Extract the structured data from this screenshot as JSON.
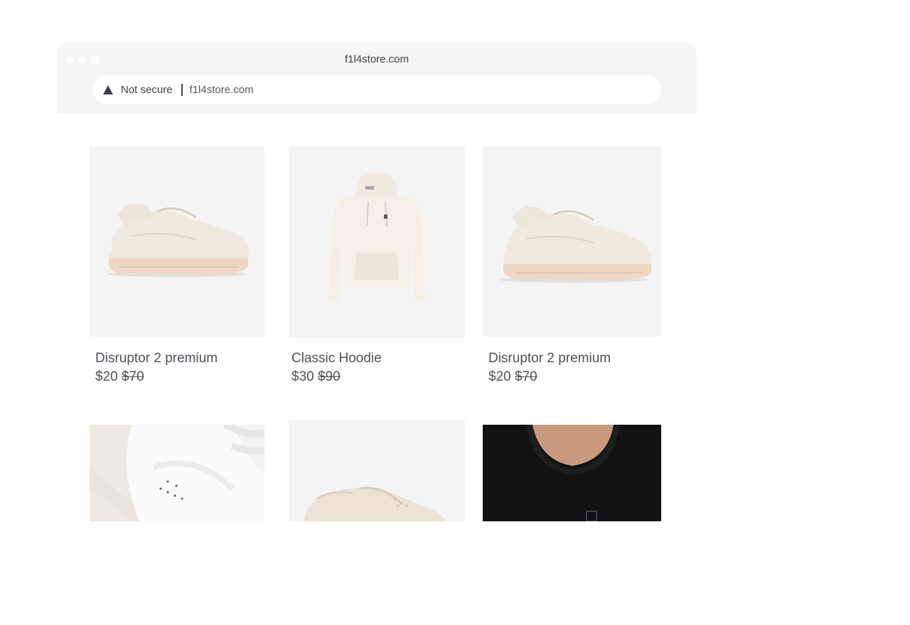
{
  "window": {
    "title": "f1l4store.com"
  },
  "address_bar": {
    "security_label": "Not secure",
    "url": "f1l4store.com",
    "security_icon": "warning-triangle-icon"
  },
  "products": [
    {
      "name": "Disruptor 2 premium",
      "price": "$20",
      "original_price": "$70",
      "image": "cream chunky sneaker"
    },
    {
      "name": "Classic Hoodie",
      "price": "$30",
      "original_price": "$90",
      "image": "cream hoodie"
    },
    {
      "name": "Disruptor 2 premium",
      "price": "$20",
      "original_price": "$70",
      "image": "cream chunky sneaker"
    },
    {
      "name": "",
      "price": "",
      "original_price": "",
      "image": "white leather sneaker close-up"
    },
    {
      "name": "",
      "price": "",
      "original_price": "",
      "image": "cream low-top sneaker"
    },
    {
      "name": "",
      "price": "",
      "original_price": "",
      "image": "black t-shirt on model"
    }
  ],
  "colors": {
    "chrome_bg": "#f5f5f5",
    "text": "#505059",
    "image_bg": "#f4f4f4"
  }
}
